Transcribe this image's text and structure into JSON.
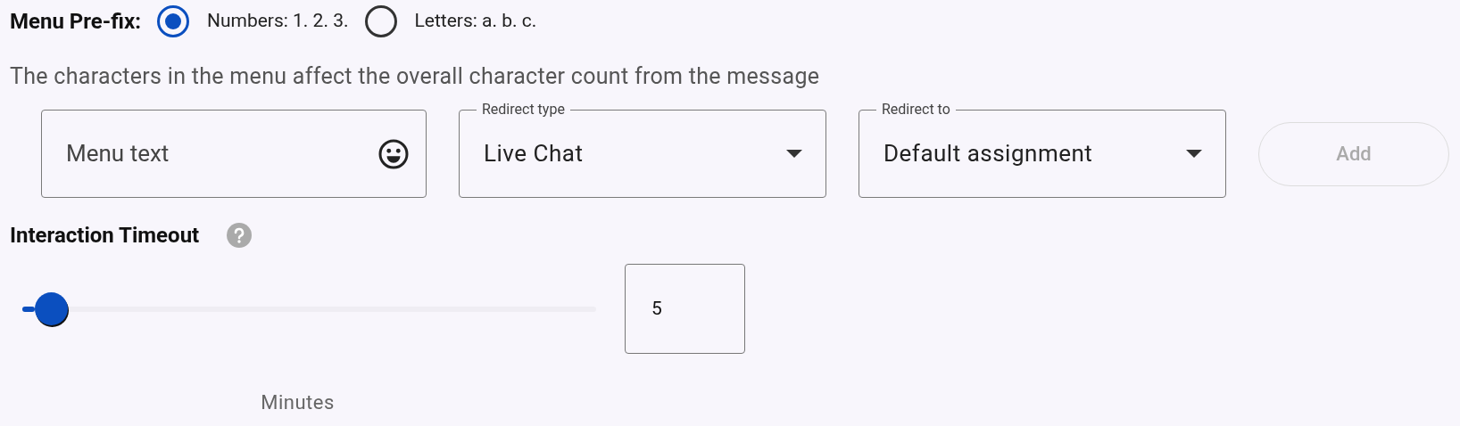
{
  "menu_prefix": {
    "label": "Menu Pre-fix:",
    "options": [
      {
        "label": "Numbers: 1. 2. 3.",
        "selected": true
      },
      {
        "label": "Letters: a. b. c.",
        "selected": false
      }
    ]
  },
  "description": "The characters in the menu affect the overall character count from the message",
  "menu_text": {
    "placeholder": "Menu text"
  },
  "redirect_type": {
    "label": "Redirect type",
    "value": "Live Chat"
  },
  "redirect_to": {
    "label": "Redirect to",
    "value": "Default assignment"
  },
  "add_button": {
    "label": "Add",
    "disabled": true
  },
  "interaction_timeout": {
    "label": "Interaction Timeout",
    "level": 0.05,
    "value": "5",
    "unit": "Minutes"
  }
}
